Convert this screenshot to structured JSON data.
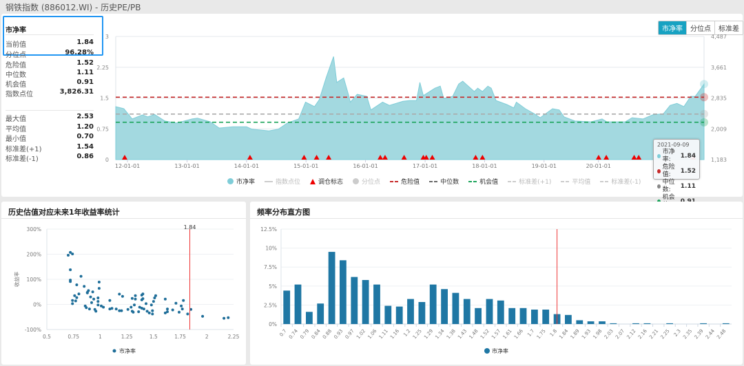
{
  "window_title": "钢铁指数 (886012.WI) - 历史PE/PB",
  "info": {
    "heading": "市净率",
    "rows_top": [
      {
        "label": "当前值",
        "value": "1.84"
      },
      {
        "label": "分位点",
        "value": "96.28%"
      },
      {
        "label": "危险值",
        "value": "1.52"
      },
      {
        "label": "中位数",
        "value": "1.11"
      },
      {
        "label": "机会值",
        "value": "0.91"
      },
      {
        "label": "指数点位",
        "value": "3,826.31"
      }
    ],
    "rows_bottom": [
      {
        "label": "最大值",
        "value": "2.53"
      },
      {
        "label": "平均值",
        "value": "1.20"
      },
      {
        "label": "最小值",
        "value": "0.70"
      },
      {
        "label": "标准差(+1)",
        "value": "1.54"
      },
      {
        "label": "标准差(-1)",
        "value": "0.86"
      }
    ]
  },
  "tabs": [
    {
      "label": "市净率",
      "active": true
    },
    {
      "label": "分位点",
      "active": false
    },
    {
      "label": "标准差",
      "active": false
    }
  ],
  "colors": {
    "area": "#a3d9e0",
    "line": "#7fcdd8",
    "danger": "#c62828",
    "median": "#9e9e9e",
    "chance": "#1aa35a",
    "signal": "#ee0000",
    "bar": "#1f77a4",
    "scatter": "#1f6e99",
    "accent": "#17a2c2",
    "marker": "#ee3333"
  },
  "legend": [
    {
      "label": "市净率",
      "icon": "circle",
      "color": "#7fcdd8",
      "active": true
    },
    {
      "label": "指数点位",
      "icon": "line",
      "color": "#ccc",
      "active": false
    },
    {
      "label": "调仓标志",
      "icon": "triangle",
      "color": "#ee0000",
      "active": true
    },
    {
      "label": "分位点",
      "icon": "circle",
      "color": "#ccc",
      "active": false
    },
    {
      "label": "危险值",
      "icon": "dash",
      "color": "#c62828",
      "active": true
    },
    {
      "label": "中位数",
      "icon": "dash",
      "color": "#666",
      "active": true
    },
    {
      "label": "机会值",
      "icon": "dash",
      "color": "#1aa35a",
      "active": true
    },
    {
      "label": "标准差(+1)",
      "icon": "dash",
      "color": "#ccc",
      "active": false
    },
    {
      "label": "平均值",
      "icon": "dash",
      "color": "#ccc",
      "active": false
    },
    {
      "label": "标准差(-1)",
      "icon": "dash",
      "color": "#ccc",
      "active": false
    }
  ],
  "tooltip": {
    "date": "2021-09-09",
    "rows": [
      {
        "label": "市净率:",
        "value": "1.84",
        "color": "#7fcdd8"
      },
      {
        "label": "危险值:",
        "value": "1.52",
        "color": "#c62828"
      },
      {
        "label": "中位数:",
        "value": "1.11",
        "color": "#888"
      },
      {
        "label": "机会值:",
        "value": "0.91",
        "color": "#1aa35a"
      }
    ]
  },
  "chart_data": [
    {
      "type": "area",
      "xlim": [
        "2011-10-21",
        "2021-09-09"
      ],
      "ylim": [
        0,
        3
      ],
      "y_ticks": [
        "0",
        "0.75",
        "1.5",
        "2.25",
        "3"
      ],
      "y2_ticks": [
        "1,183",
        "2,009",
        "2,835",
        "3,661",
        "4,487"
      ],
      "x_ticks": [
        {
          "label": "12-01-01",
          "date": "2012-01-01"
        },
        {
          "label": "13-01-01",
          "date": "2013-01-01"
        },
        {
          "label": "14-01-01",
          "date": "2014-01-01"
        },
        {
          "label": "15-01-01",
          "date": "2015-01-01"
        },
        {
          "label": "16-01-01",
          "date": "2016-01-01"
        },
        {
          "label": "17-01-01",
          "date": "2017-01-01"
        },
        {
          "label": "18-01-01",
          "date": "2018-01-01"
        },
        {
          "label": "19-01-01",
          "date": "2019-01-01"
        },
        {
          "label": "20-01-01",
          "date": "2019-12-01"
        }
      ],
      "reference_lines": {
        "danger": 1.52,
        "median": 1.11,
        "chance": 0.91
      },
      "series": [
        [
          "2011-10-21",
          1.29
        ],
        [
          "2011-12-10",
          1.24
        ],
        [
          "2012-01-30",
          0.99
        ],
        [
          "2012-04-02",
          1.09
        ],
        [
          "2012-05-05",
          1.04
        ],
        [
          "2012-06-16",
          1.1
        ],
        [
          "2012-08-18",
          0.94
        ],
        [
          "2012-10-28",
          0.89
        ],
        [
          "2013-02-01",
          0.99
        ],
        [
          "2013-03-06",
          1.01
        ],
        [
          "2013-05-24",
          0.92
        ],
        [
          "2013-07-17",
          0.77
        ],
        [
          "2013-10-09",
          0.8
        ],
        [
          "2014-01-01",
          0.8
        ],
        [
          "2014-02-03",
          0.74
        ],
        [
          "2014-05-18",
          0.7
        ],
        [
          "2014-07-15",
          0.74
        ],
        [
          "2014-09-08",
          0.89
        ],
        [
          "2014-11-17",
          0.99
        ],
        [
          "2014-12-29",
          1.4
        ],
        [
          "2015-02-22",
          1.29
        ],
        [
          "2015-03-23",
          1.46
        ],
        [
          "2015-05-04",
          1.99
        ],
        [
          "2015-06-19",
          2.51
        ],
        [
          "2015-07-09",
          1.88
        ],
        [
          "2015-08-20",
          1.99
        ],
        [
          "2015-09-18",
          1.59
        ],
        [
          "2015-09-30",
          1.4
        ],
        [
          "2015-11-11",
          1.59
        ],
        [
          "2016-01-09",
          1.54
        ],
        [
          "2016-02-03",
          1.21
        ],
        [
          "2016-04-15",
          1.4
        ],
        [
          "2016-05-27",
          1.32
        ],
        [
          "2016-08-18",
          1.42
        ],
        [
          "2016-09-28",
          1.44
        ],
        [
          "2016-11-09",
          1.44
        ],
        [
          "2016-11-30",
          1.88
        ],
        [
          "2016-12-21",
          1.56
        ],
        [
          "2017-03-02",
          1.74
        ],
        [
          "2017-04-04",
          1.79
        ],
        [
          "2017-04-25",
          1.49
        ],
        [
          "2017-06-19",
          1.54
        ],
        [
          "2017-07-26",
          1.84
        ],
        [
          "2017-08-20",
          1.91
        ],
        [
          "2017-10-01",
          1.76
        ],
        [
          "2017-10-30",
          1.66
        ],
        [
          "2017-11-20",
          1.74
        ],
        [
          "2017-12-19",
          1.66
        ],
        [
          "2018-01-21",
          1.79
        ],
        [
          "2018-02-11",
          1.74
        ],
        [
          "2018-03-12",
          1.44
        ],
        [
          "2018-05-18",
          1.34
        ],
        [
          "2018-06-29",
          1.26
        ],
        [
          "2018-07-15",
          1.4
        ],
        [
          "2018-09-08",
          1.24
        ],
        [
          "2018-11-01",
          1.12
        ],
        [
          "2018-12-08",
          1.02
        ],
        [
          "2019-02-22",
          1.24
        ],
        [
          "2019-04-04",
          1.21
        ],
        [
          "2019-05-04",
          1.04
        ],
        [
          "2019-07-09",
          0.94
        ],
        [
          "2019-10-17",
          0.92
        ],
        [
          "2019-12-23",
          0.99
        ],
        [
          "2020-01-21",
          0.92
        ],
        [
          "2020-05-14",
          0.92
        ],
        [
          "2020-06-24",
          1.02
        ],
        [
          "2020-08-30",
          0.99
        ],
        [
          "2020-10-28",
          1.09
        ],
        [
          "2021-01-03",
          1.12
        ],
        [
          "2021-02-13",
          1.32
        ],
        [
          "2021-03-27",
          1.37
        ],
        [
          "2021-05-08",
          1.29
        ],
        [
          "2021-06-19",
          1.54
        ],
        [
          "2021-07-17",
          1.54
        ],
        [
          "2021-09-09",
          1.84
        ]
      ],
      "signals": [
        "2011-12-15",
        "2014-01-22",
        "2014-12-20",
        "2015-03-07",
        "2015-05-20",
        "2016-04-01",
        "2016-04-30",
        "2016-08-25",
        "2016-12-21",
        "2017-01-08",
        "2017-02-14",
        "2017-11-07",
        "2017-12-19",
        "2019-12-02",
        "2020-01-18",
        "2020-07-07",
        "2020-08-04",
        "2021-07-05"
      ]
    },
    {
      "type": "scatter",
      "title": "历史估值对应未来1年收益率统计",
      "ylabel": "收益率",
      "legend": "市净率",
      "xlim": [
        0.5,
        2.25
      ],
      "ylim": [
        -100,
        300
      ],
      "x_ticks": [
        "0.5",
        "0.75",
        "1",
        "1.25",
        "1.5",
        "1.75",
        "2",
        "2.25"
      ],
      "y_ticks": [
        "300%",
        "200%",
        "100%",
        "0%",
        "-100%"
      ],
      "marker_value": "1.84",
      "points": [
        [
          0.7,
          196
        ],
        [
          0.72,
          207
        ],
        [
          0.74,
          201
        ],
        [
          0.72,
          138
        ],
        [
          0.72,
          91
        ],
        [
          0.72,
          97
        ],
        [
          0.82,
          112
        ],
        [
          0.78,
          78
        ],
        [
          0.85,
          72
        ],
        [
          0.8,
          42
        ],
        [
          0.76,
          35
        ],
        [
          0.74,
          16
        ],
        [
          0.74,
          3
        ],
        [
          0.78,
          27
        ],
        [
          0.77,
          14
        ],
        [
          0.88,
          48
        ],
        [
          0.89,
          55
        ],
        [
          0.88,
          46
        ],
        [
          0.93,
          50
        ],
        [
          0.91,
          30
        ],
        [
          0.94,
          21
        ],
        [
          0.92,
          7
        ],
        [
          0.86,
          -6
        ],
        [
          0.87,
          -13
        ],
        [
          0.9,
          -18
        ],
        [
          0.95,
          -20
        ],
        [
          0.96,
          -27
        ],
        [
          0.99,
          89
        ],
        [
          0.99,
          64
        ],
        [
          0.98,
          26
        ],
        [
          0.98,
          12
        ],
        [
          0.98,
          -2
        ],
        [
          1.01,
          -6
        ],
        [
          1.03,
          -11
        ],
        [
          1.09,
          16
        ],
        [
          1.09,
          -18
        ],
        [
          1.11,
          -16
        ],
        [
          1.15,
          -18
        ],
        [
          1.18,
          41
        ],
        [
          1.21,
          32
        ],
        [
          1.18,
          -25
        ],
        [
          1.2,
          -25
        ],
        [
          1.26,
          -20
        ],
        [
          1.29,
          -11
        ],
        [
          1.3,
          -27
        ],
        [
          1.31,
          -31
        ],
        [
          1.3,
          24
        ],
        [
          1.33,
          21
        ],
        [
          1.33,
          35
        ],
        [
          1.32,
          -2
        ],
        [
          1.36,
          -29
        ],
        [
          1.37,
          -11
        ],
        [
          1.39,
          -15
        ],
        [
          1.39,
          37
        ],
        [
          1.4,
          42
        ],
        [
          1.39,
          18
        ],
        [
          1.4,
          23
        ],
        [
          1.41,
          -18
        ],
        [
          1.43,
          3
        ],
        [
          1.44,
          -27
        ],
        [
          1.46,
          -34
        ],
        [
          1.48,
          -2
        ],
        [
          1.49,
          -25
        ],
        [
          1.5,
          12
        ],
        [
          1.51,
          26
        ],
        [
          1.52,
          35
        ],
        [
          1.49,
          -38
        ],
        [
          1.61,
          21
        ],
        [
          1.61,
          -34
        ],
        [
          1.63,
          -18
        ],
        [
          1.63,
          -29
        ],
        [
          1.68,
          -22
        ],
        [
          1.71,
          5
        ],
        [
          1.74,
          -31
        ],
        [
          1.76,
          -6
        ],
        [
          1.77,
          -18
        ],
        [
          1.78,
          16
        ],
        [
          1.82,
          -38
        ],
        [
          1.85,
          -20
        ],
        [
          1.96,
          -47
        ],
        [
          2.16,
          -55
        ],
        [
          2.2,
          -53
        ]
      ]
    },
    {
      "type": "bar",
      "title": "频率分布直方图",
      "legend": "市净率",
      "ylim": [
        0,
        12.5
      ],
      "y_ticks": [
        "12.5%",
        "10%",
        "7.5%",
        "5%",
        "2.5%",
        "0%"
      ],
      "marker_category": "1.8",
      "categories": [
        "0.7",
        "0.74",
        "0.79",
        "0.84",
        "0.88",
        "0.93",
        "0.97",
        "1.02",
        "1.06",
        "1.11",
        "1.16",
        "1.2",
        "1.25",
        "1.29",
        "1.34",
        "1.38",
        "1.43",
        "1.48",
        "1.52",
        "1.57",
        "1.61",
        "1.66",
        "1.7",
        "1.75",
        "1.8",
        "1.84",
        "1.89",
        "1.93",
        "1.98",
        "2.03",
        "2.07",
        "2.12",
        "2.16",
        "2.21",
        "2.25",
        "2.3",
        "2.35",
        "2.39",
        "2.44",
        "2.48"
      ],
      "values": [
        4.4,
        5.2,
        1.6,
        2.7,
        9.5,
        8.4,
        6.2,
        5.8,
        5.2,
        2.4,
        2.3,
        3.3,
        2.9,
        5.2,
        4.6,
        4.1,
        3.3,
        2.1,
        3.3,
        3.1,
        2.1,
        2.1,
        1.9,
        1.9,
        1.3,
        1.2,
        0.5,
        0.35,
        0.35,
        0.1,
        0,
        0.1,
        0.1,
        0,
        0.1,
        0,
        0,
        0.1,
        0,
        0.1
      ]
    }
  ]
}
